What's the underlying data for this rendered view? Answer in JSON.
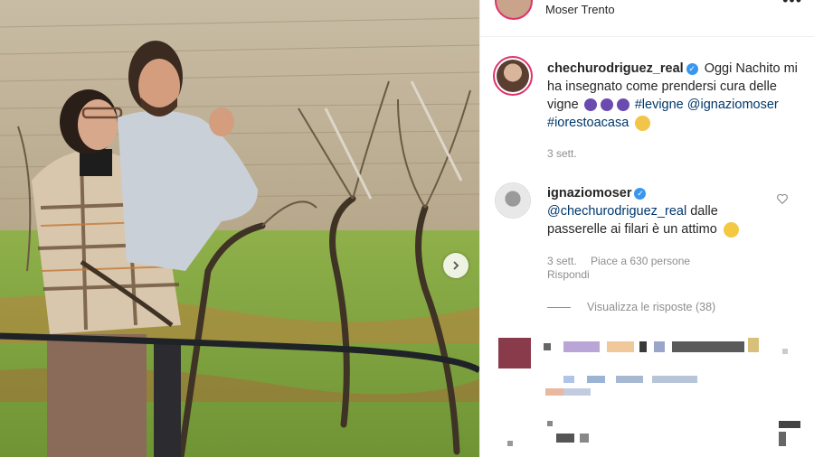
{
  "post_header": {
    "location": "Moser Trento",
    "more_label": "•••"
  },
  "caption": {
    "username": "chechurodriguez_real",
    "text_1": "Oggi Nachito mi ha insegnato come prendersi cura delle vigne",
    "hashtag_1": "#levigne",
    "mention": "@ignaziomoser",
    "hashtag_2": "#iorestoacasa",
    "time": "3 sett."
  },
  "comment": {
    "username": "ignaziomoser",
    "mention": "@chechurodriguez_real",
    "text": "dalle passerelle ai filari è un attimo",
    "time": "3 sett.",
    "likes": "Piace a 630 persone",
    "reply_label": "Rispondi",
    "view_replies": "Visualizza le risposte (38)"
  },
  "colors": {
    "accent_ring": "#e1306c",
    "verified": "#3897f0",
    "link": "#00376b",
    "meta": "#8e8e8e"
  },
  "icons": [
    "verified-icon",
    "grape-icon",
    "heart-icon",
    "chevron-right-icon",
    "more-icon"
  ]
}
